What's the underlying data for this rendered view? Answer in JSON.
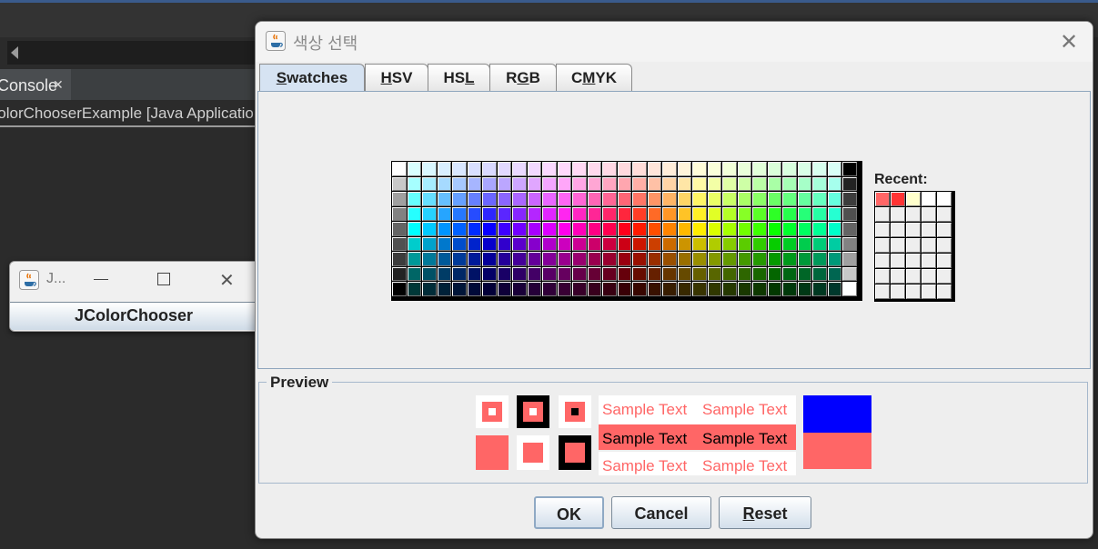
{
  "ide": {
    "console_tab": "Console",
    "console_title": "ColorChooserExample [Java Application]"
  },
  "small_window": {
    "title": "J...",
    "button": "JColorChooser"
  },
  "dialog": {
    "title": "색상 선택",
    "tabs": [
      {
        "label": "Swatches",
        "mnemonic": "S"
      },
      {
        "label": "HSV",
        "mnemonic": "H"
      },
      {
        "label": "HSL",
        "mnemonic": "L"
      },
      {
        "label": "RGB",
        "mnemonic": "G"
      },
      {
        "label": "CMYK",
        "mnemonic": "M"
      }
    ],
    "active_tab": "Swatches",
    "recent_label": "Recent:",
    "recent_colors": [
      "#ff6666",
      "#ff3333",
      "#ffffcc",
      "#ffffff",
      "#ffffff"
    ],
    "preview_label": "Preview",
    "sample_text": "Sample Text",
    "preview_color": "#ff6666",
    "previous_color": "#0000ff",
    "buttons": {
      "ok": "OK",
      "cancel": "Cancel",
      "reset": "Reset"
    }
  }
}
